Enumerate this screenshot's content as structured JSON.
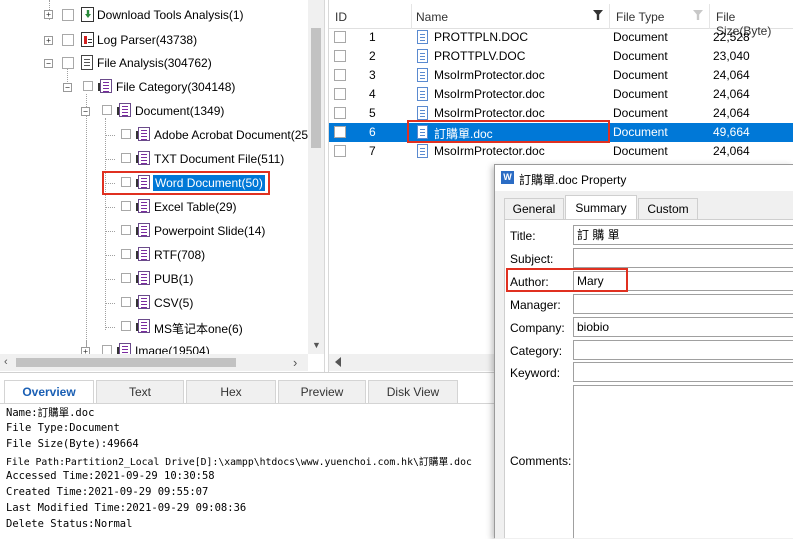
{
  "tree": {
    "items": [
      {
        "label": "Download Tools Analysis(1)"
      },
      {
        "label": "Log Parser(43738)"
      },
      {
        "label": "File Analysis(304762)"
      },
      {
        "label": "File Category(304148)"
      },
      {
        "label": "Document(1349)"
      },
      {
        "label": "Adobe Acrobat Document(25"
      },
      {
        "label": "TXT Document File(511)"
      },
      {
        "label": "Word Document(50)"
      },
      {
        "label": "Excel Table(29)"
      },
      {
        "label": "Powerpoint Slide(14)"
      },
      {
        "label": "RTF(708)"
      },
      {
        "label": "PUB(1)"
      },
      {
        "label": "CSV(5)"
      },
      {
        "label": "MS笔记本one(6)"
      },
      {
        "label": "Image(19504)"
      }
    ],
    "expand_plus": "+",
    "expand_minus": "−"
  },
  "table": {
    "columns": [
      "ID",
      "Name",
      "File Type",
      "File Size(Byte)"
    ],
    "rows": [
      {
        "id": "1",
        "name": "PROTTPLN.DOC",
        "type": "Document",
        "size": "22,528"
      },
      {
        "id": "2",
        "name": "PROTTPLV.DOC",
        "type": "Document",
        "size": "23,040"
      },
      {
        "id": "3",
        "name": "MsoIrmProtector.doc",
        "type": "Document",
        "size": "24,064"
      },
      {
        "id": "4",
        "name": "MsoIrmProtector.doc",
        "type": "Document",
        "size": "24,064"
      },
      {
        "id": "5",
        "name": "MsoIrmProtector.doc",
        "type": "Document",
        "size": "24,064"
      },
      {
        "id": "6",
        "name": "訂購單.doc",
        "type": "Document",
        "size": "49,664"
      },
      {
        "id": "7",
        "name": "MsoIrmProtector.doc",
        "type": "Document",
        "size": "24,064"
      }
    ],
    "selected_index": 5
  },
  "bottom_tabs": [
    "Overview",
    "Text",
    "Hex",
    "Preview",
    "Disk View"
  ],
  "overview": [
    "Name:訂購單.doc",
    "File Type:Document",
    "File Size(Byte):49664",
    "File Path:Partition2_Local Drive[D]:\\xampp\\htdocs\\www.yuenchoi.com.hk\\訂購單.doc",
    "Accessed Time:2021-09-29 10:30:58",
    "Created Time:2021-09-29 09:55:07",
    "Last Modified Time:2021-09-29 09:08:36",
    "Delete Status:Normal"
  ],
  "property": {
    "title": "訂購單.doc Property",
    "app_icon": "W",
    "tabs": [
      "General",
      "Summary",
      "Custom"
    ],
    "active_tab": "Summary",
    "fields": [
      {
        "label": "Title:",
        "value": "訂  購  單"
      },
      {
        "label": "Subject:",
        "value": ""
      },
      {
        "label": "Author:",
        "value": "Mary"
      },
      {
        "label": "Manager:",
        "value": ""
      },
      {
        "label": "Company:",
        "value": "biobio"
      },
      {
        "label": "Category:",
        "value": ""
      },
      {
        "label": "Keyword:",
        "value": ""
      }
    ],
    "comments_label": "Comments:",
    "comments_value": ""
  },
  "colors": {
    "selection": "#0078d7",
    "highlight_box": "#e03020",
    "tab_active_text": "#1a5fb4"
  }
}
